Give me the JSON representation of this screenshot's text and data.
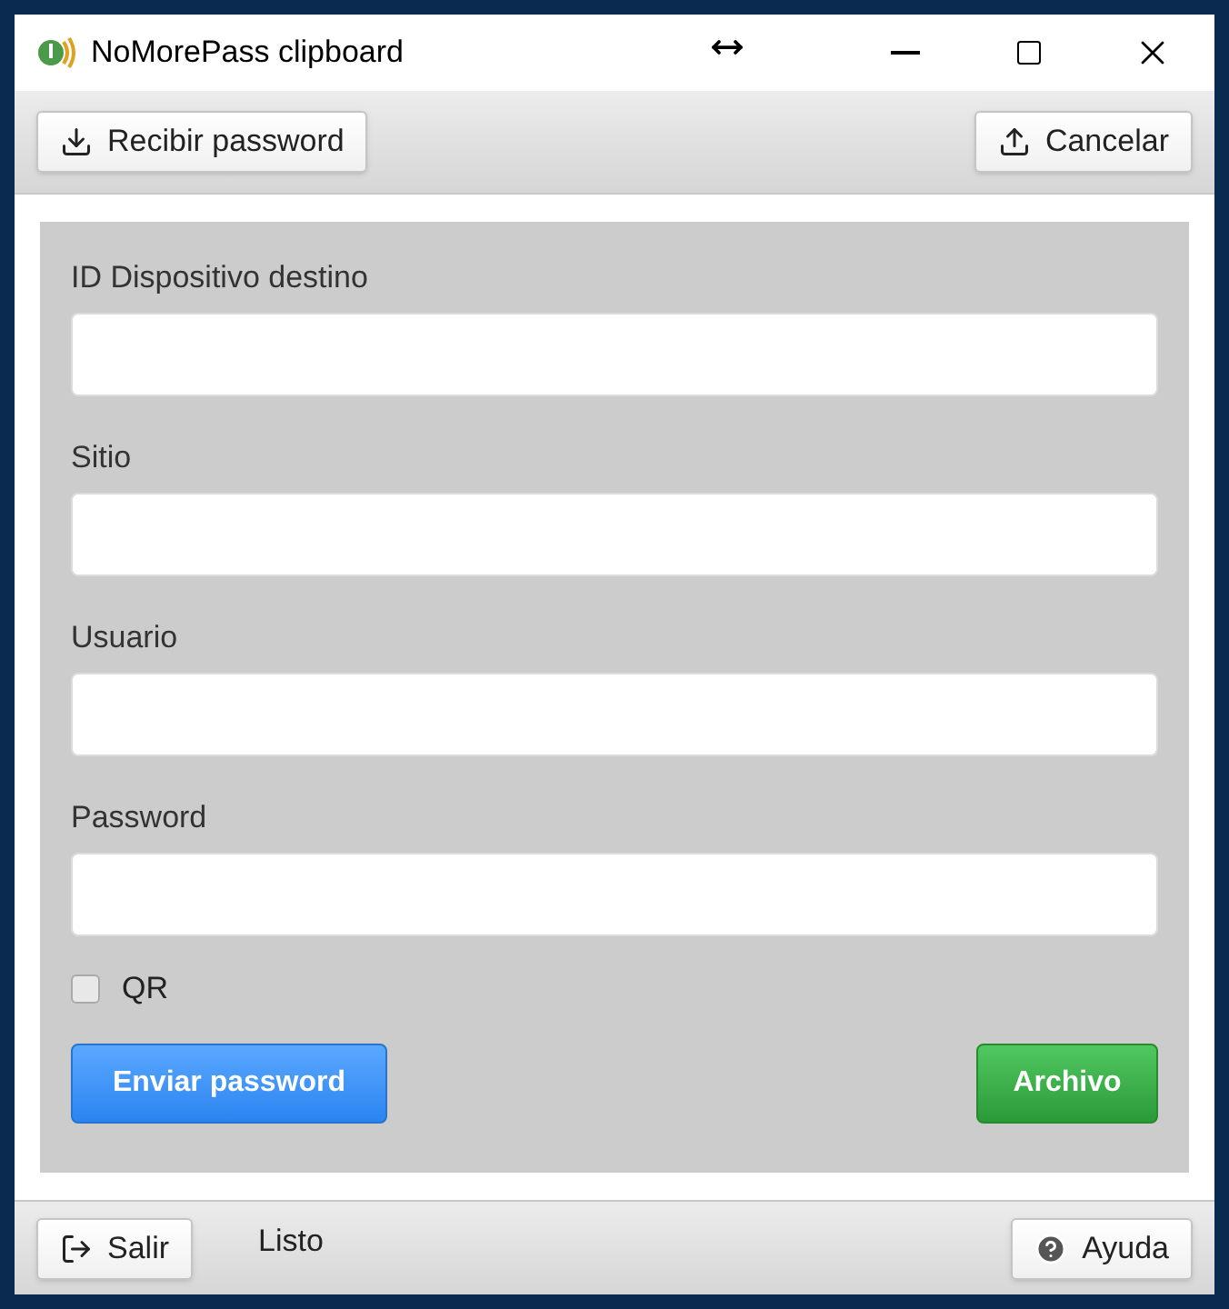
{
  "window": {
    "title": "NoMorePass clipboard"
  },
  "toolbar": {
    "receive_button": "Recibir password",
    "cancel_button": "Cancelar"
  },
  "form": {
    "fields": [
      {
        "label": "ID Dispositivo destino"
      },
      {
        "label": "Sitio"
      },
      {
        "label": "Usuario"
      },
      {
        "label": "Password"
      }
    ],
    "qr": {
      "label": "QR",
      "checked": false
    },
    "send_button": "Enviar password",
    "file_button": "Archivo"
  },
  "status_bar": {
    "exit_button": "Salir",
    "status": "Listo",
    "help_button": "Ayuda"
  }
}
